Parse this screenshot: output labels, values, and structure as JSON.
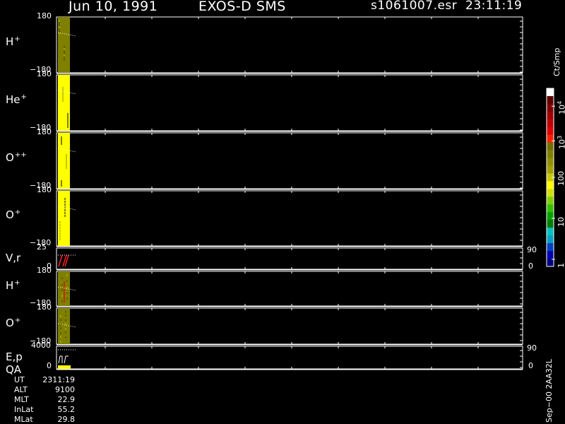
{
  "header": {
    "date": "Jun 10, 1991",
    "instrument": "EXOS-D SMS",
    "file": "s1061007.esr",
    "time": "23:11:19"
  },
  "panels": [
    {
      "label": "H",
      "sup": "+",
      "ymax": "180",
      "ymin": "−180"
    },
    {
      "label": "He",
      "sup": "+",
      "ymax": "180",
      "ymin": "−180"
    },
    {
      "label": "O",
      "sup": "++",
      "ymax": "180",
      "ymin": "−180"
    },
    {
      "label": "O",
      "sup": "+",
      "ymax": "180",
      "ymin": "−180"
    },
    {
      "label": "V,r",
      "sup": "",
      "ymax": "25",
      "ymin": "0",
      "rmax": "90",
      "rmin": "0"
    },
    {
      "label": "H",
      "sup": "+",
      "ymax": "180",
      "ymin": "−180"
    },
    {
      "label": "O",
      "sup": "+",
      "ymax": "180",
      "ymin": "−180"
    },
    {
      "label": "E,p",
      "label2": "QA",
      "sup": "",
      "ymax": "4000",
      "ymin": "0",
      "rmax": "90",
      "rmin": "0"
    }
  ],
  "colorbar": {
    "unit": "Ct/Smp",
    "ticks": [
      {
        "base": "10",
        "exp": "4",
        "frac": 0.9
      },
      {
        "base": "10",
        "exp": "3",
        "frac": 0.705
      },
      {
        "base": "100",
        "exp": "",
        "frac": 0.5
      },
      {
        "base": "10",
        "exp": "",
        "frac": 0.27
      },
      {
        "base": "1",
        "exp": "",
        "frac": 0.04
      }
    ],
    "colors": [
      "#000080",
      "#0000b0",
      "#0040c0",
      "#00a0c0",
      "#00c0c0",
      "#008000",
      "#00a000",
      "#30c000",
      "#80d000",
      "#d0e000",
      "#ffff00",
      "#c8c800",
      "#a0a000",
      "#909000",
      "#808000",
      "#707000",
      "#ff2000",
      "#e00000",
      "#c00000",
      "#a00000",
      "#800000",
      "#600000",
      "#ffffff"
    ]
  },
  "info": [
    {
      "key": "UT",
      "value": "2311:19"
    },
    {
      "key": "ALT",
      "value": "9100"
    },
    {
      "key": "MLT",
      "value": "22.9"
    },
    {
      "key": "InLat",
      "value": "55.2"
    },
    {
      "key": "MLat",
      "value": "29.8"
    }
  ],
  "footer": "Sep−00 2AA32L"
}
